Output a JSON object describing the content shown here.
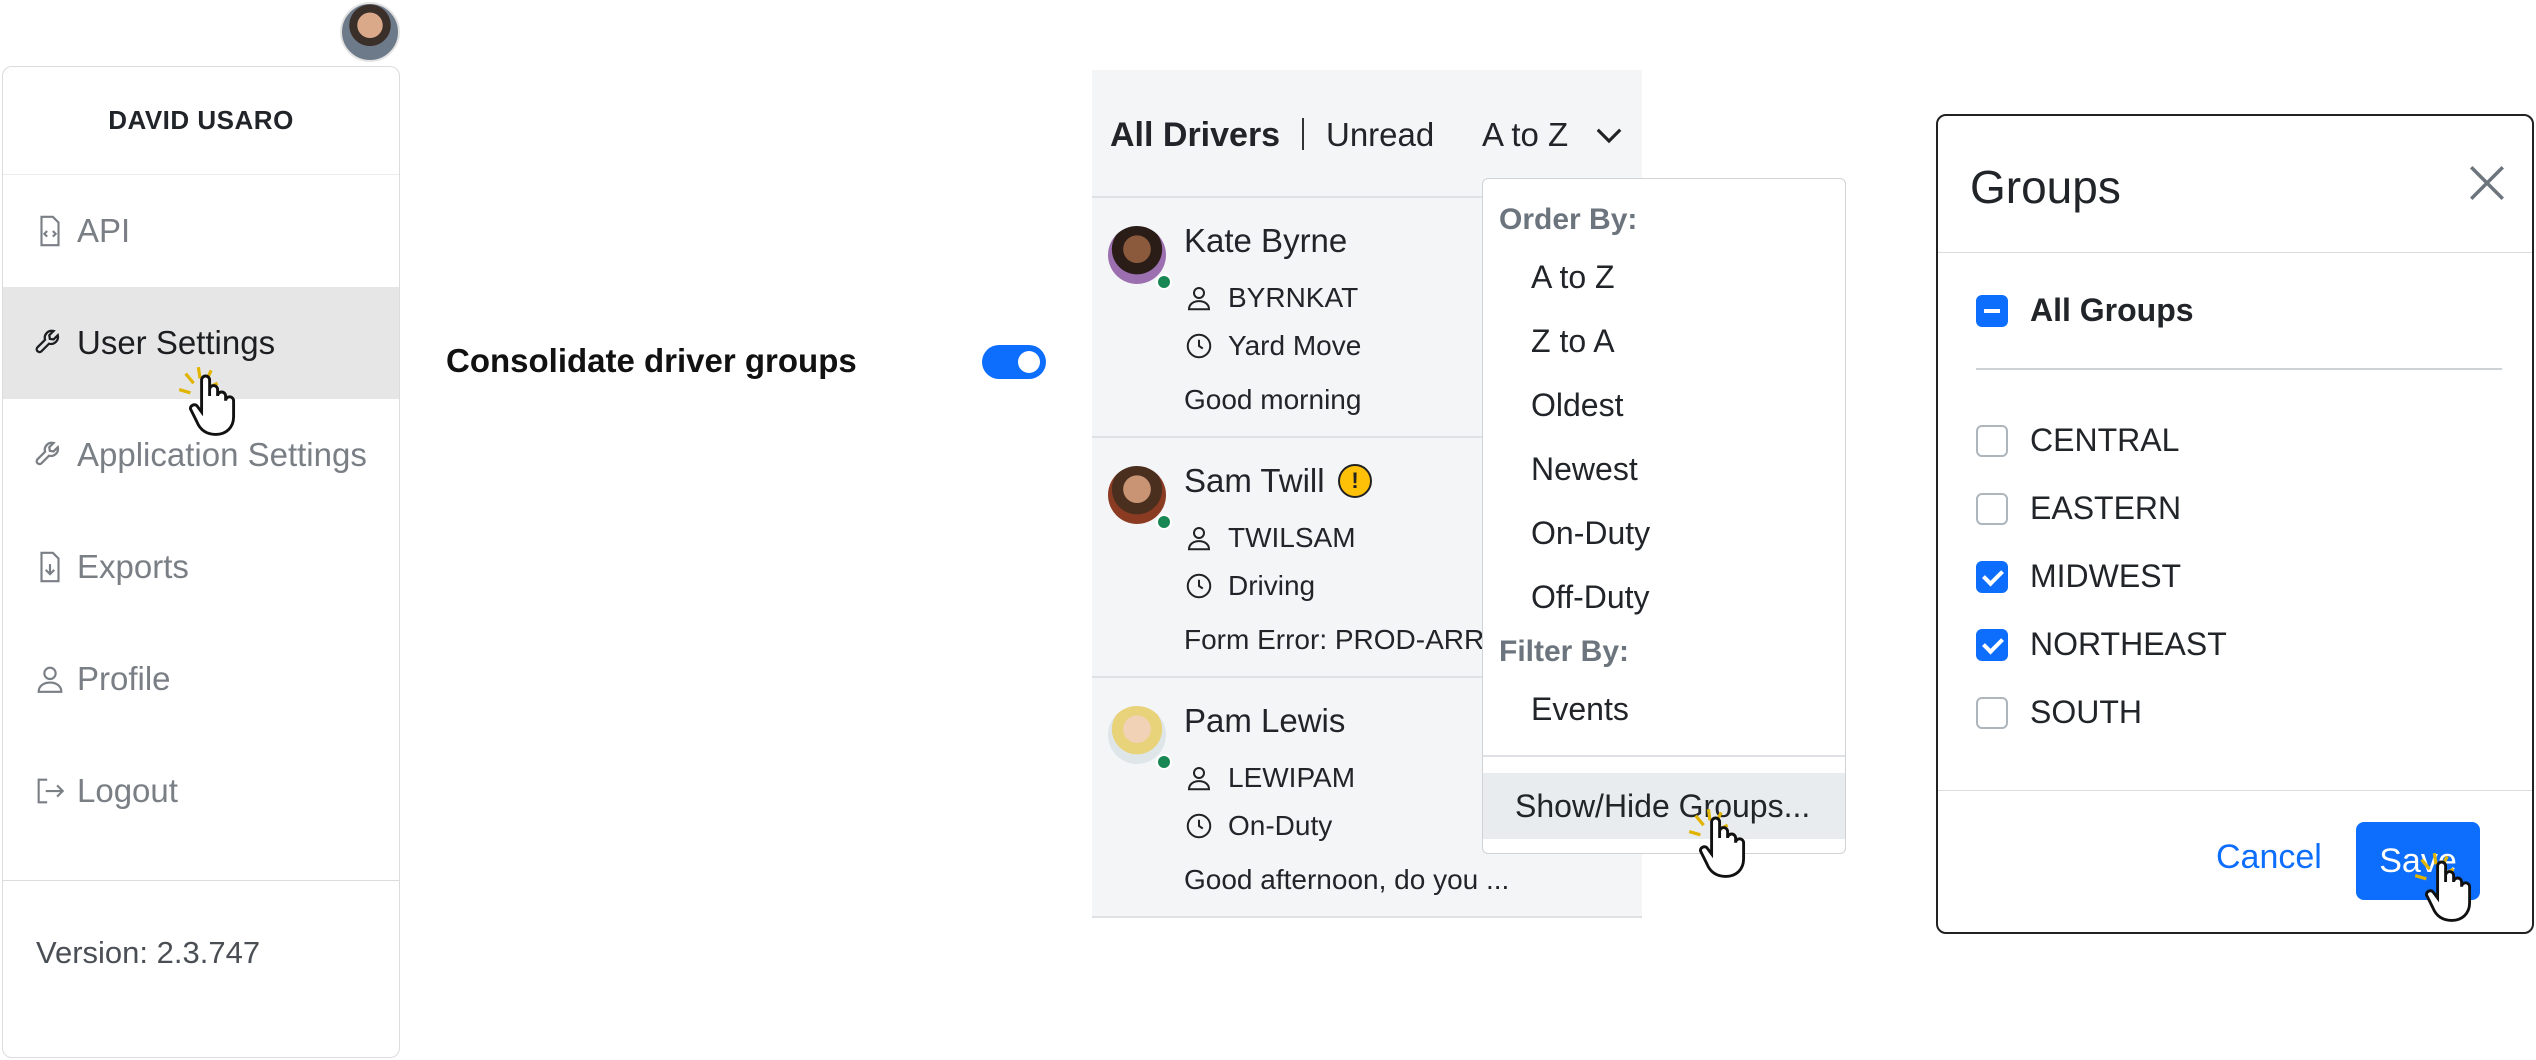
{
  "sidebar": {
    "user_name": "DAVID USARO",
    "items": [
      {
        "label": "API",
        "icon": "file-code-icon"
      },
      {
        "label": "User Settings",
        "icon": "wrench-icon"
      },
      {
        "label": "Application Settings",
        "icon": "wrench-icon"
      },
      {
        "label": "Exports",
        "icon": "file-download-icon"
      },
      {
        "label": "Profile",
        "icon": "person-icon"
      },
      {
        "label": "Logout",
        "icon": "logout-icon"
      }
    ],
    "active": "User Settings",
    "version": "Version: 2.3.747"
  },
  "settings": {
    "consolidate_label": "Consolidate driver groups",
    "consolidate_on": true
  },
  "drivers": {
    "tab_all": "All Drivers",
    "tab_unread": "Unread",
    "sort_label": "A to Z",
    "list": [
      {
        "name": "Kate Byrne",
        "code": "BYRNKAT",
        "status": "Yard Move",
        "message": "Good morning",
        "warning": false
      },
      {
        "name": "Sam Twill",
        "code": "TWILSAM",
        "status": "Driving",
        "message": "Form Error: PROD-ARR",
        "warning": true
      },
      {
        "name": "Pam Lewis",
        "code": "LEWIPAM",
        "status": "On-Duty",
        "message": "Good afternoon, do you ...",
        "warning": false
      }
    ]
  },
  "sort_menu": {
    "order_header": "Order By:",
    "order_options": [
      "A to Z",
      "Z to A",
      "Oldest",
      "Newest",
      "On-Duty",
      "Off-Duty"
    ],
    "filter_header": "Filter By:",
    "filter_options": [
      "Events"
    ],
    "show_hide": "Show/Hide Groups..."
  },
  "groups_modal": {
    "title": "Groups",
    "all_label": "All Groups",
    "groups": [
      {
        "name": "CENTRAL",
        "checked": false
      },
      {
        "name": "EASTERN",
        "checked": false
      },
      {
        "name": "MIDWEST",
        "checked": true
      },
      {
        "name": "NORTHEAST",
        "checked": true
      },
      {
        "name": "SOUTH",
        "checked": false
      }
    ],
    "cancel_label": "Cancel",
    "save_label": "Save"
  },
  "colors": {
    "accent": "#0d6efd",
    "online": "#198754",
    "warning": "#ffc107"
  }
}
